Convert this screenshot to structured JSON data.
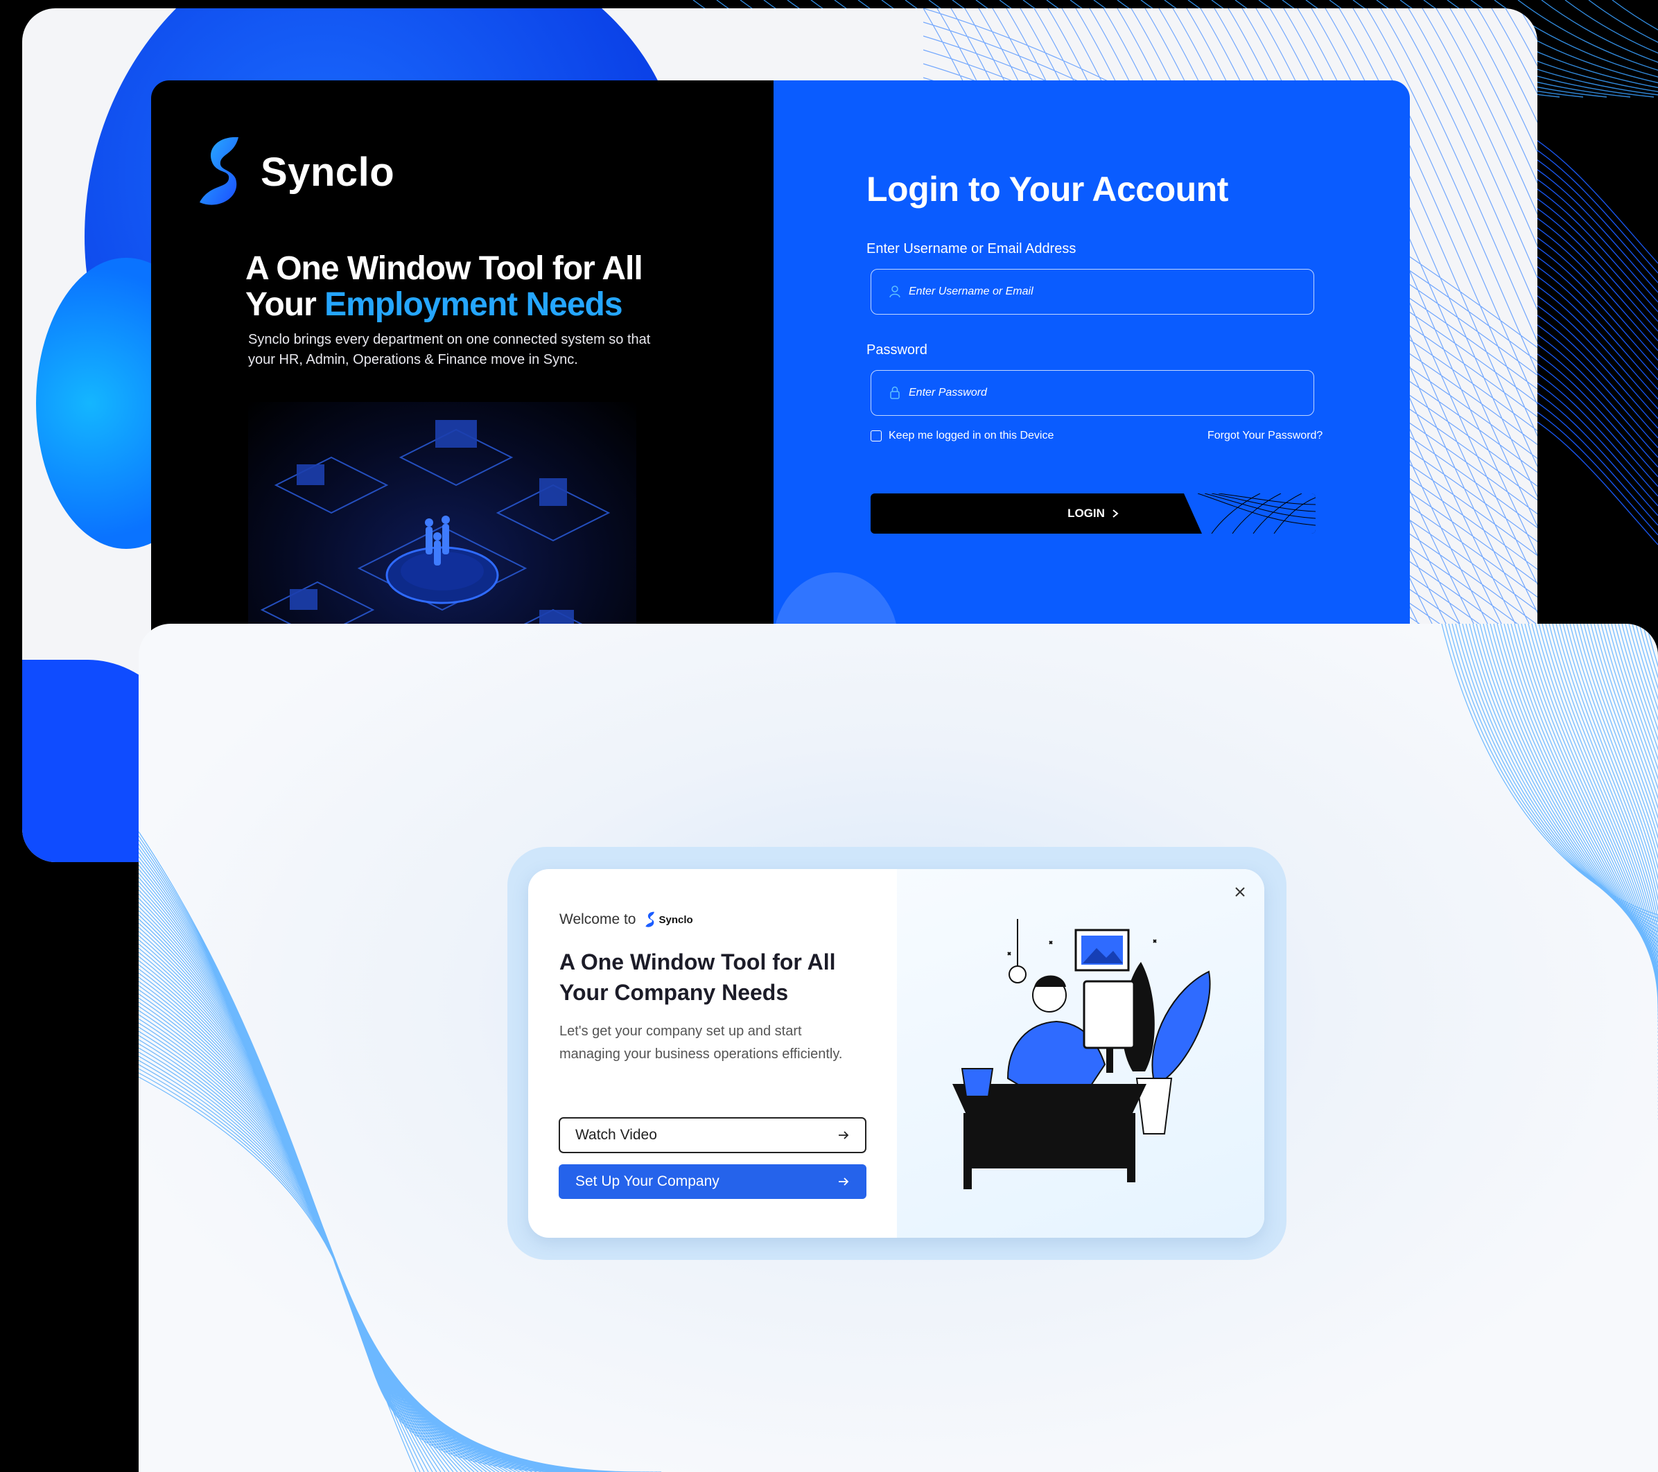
{
  "brand": {
    "name": "Synclo",
    "accent": "#25a6ff",
    "primary": "#0a5cff"
  },
  "login_page": {
    "hero_heading_line1": "A One Window Tool for All",
    "hero_heading_prefix": "Your ",
    "hero_heading_accent": "Employment Needs",
    "hero_description": "Synclo brings every department on one connected system so that your HR, Admin, Operations & Finance move in Sync.",
    "form_title": "Login to Your Account",
    "username_label": "Enter Username or Email Address",
    "username_placeholder": "Enter Username or Email",
    "password_label": "Password",
    "password_placeholder": "Enter Password",
    "remember_label": "Keep me logged in on this Device",
    "forgot_link": "Forgot Your Password?",
    "login_button": "LOGIN"
  },
  "welcome_modal": {
    "welcome_prefix": "Welcome to",
    "brand_name": "Synclo",
    "title": "A One Window Tool for All Your Company Needs",
    "description": "Let's get your company set up and start managing your business operations efficiently.",
    "watch_video_button": "Watch Video",
    "setup_button": "Set Up Your Company"
  },
  "icons": {
    "user": "user-icon",
    "lock": "lock-icon",
    "chevron": "chevron-right-icon",
    "arrow": "arrow-right-icon",
    "close": "close-icon"
  }
}
